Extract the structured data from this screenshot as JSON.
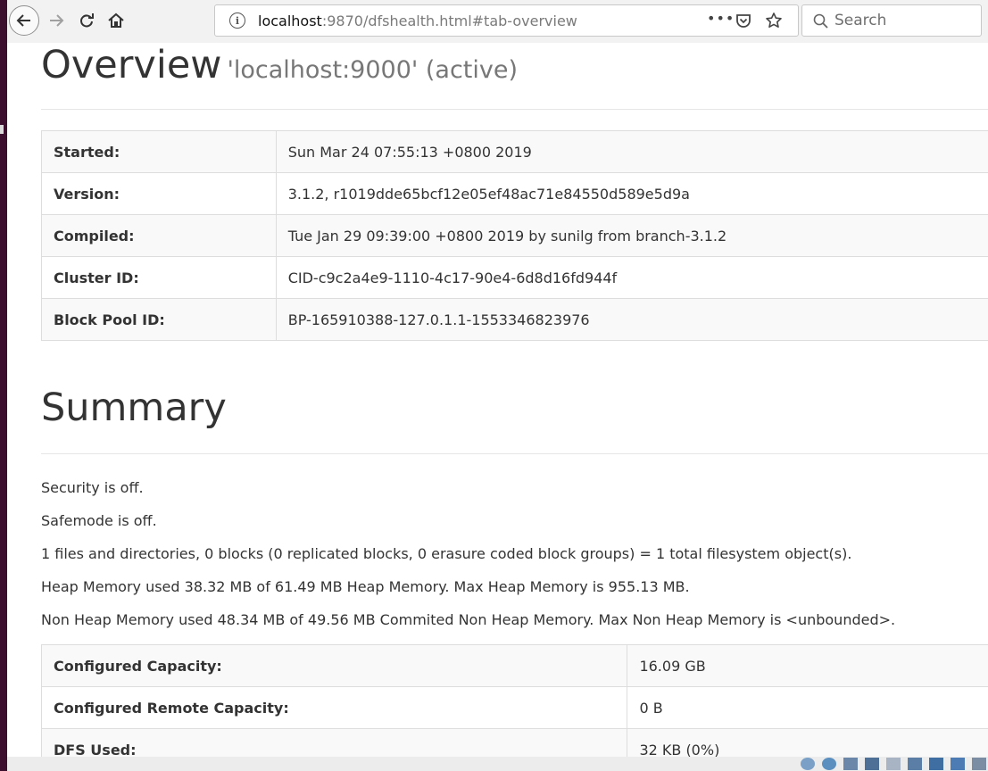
{
  "browser": {
    "url_host": "localhost",
    "url_rest": ":9870/dfshealth.html#tab-overview",
    "search_placeholder": "Search",
    "more_label": "•••"
  },
  "overview": {
    "title": "Overview",
    "subtitle": "'localhost:9000' (active)",
    "rows": [
      {
        "label": "Started:",
        "value": "Sun Mar 24 07:55:13 +0800 2019"
      },
      {
        "label": "Version:",
        "value": "3.1.2, r1019dde65bcf12e05ef48ac71e84550d589e5d9a"
      },
      {
        "label": "Compiled:",
        "value": "Tue Jan 29 09:39:00 +0800 2019 by sunilg from branch-3.1.2"
      },
      {
        "label": "Cluster ID:",
        "value": "CID-c9c2a4e9-1110-4c17-90e4-6d8d16fd944f"
      },
      {
        "label": "Block Pool ID:",
        "value": "BP-165910388-127.0.1.1-1553346823976"
      }
    ]
  },
  "summary": {
    "title": "Summary",
    "lines": [
      "Security is off.",
      "Safemode is off.",
      "1 files and directories, 0 blocks (0 replicated blocks, 0 erasure coded block groups) = 1 total filesystem object(s).",
      "Heap Memory used 38.32 MB of 61.49 MB Heap Memory. Max Heap Memory is 955.13 MB.",
      "Non Heap Memory used 48.34 MB of 49.56 MB Commited Non Heap Memory. Max Non Heap Memory is <unbounded>."
    ],
    "rows": [
      {
        "label": "Configured Capacity:",
        "value": "16.09 GB"
      },
      {
        "label": "Configured Remote Capacity:",
        "value": "0 B"
      },
      {
        "label": "DFS Used:",
        "value": "32 KB (0%)"
      }
    ]
  },
  "icons": {
    "back": "arrow-left-icon",
    "forward": "arrow-right-icon",
    "reload": "reload-icon",
    "home": "home-icon",
    "info": "info-icon",
    "pocket": "pocket-icon",
    "bookmark": "star-icon",
    "search": "search-icon"
  },
  "colors": {
    "desktop_edge": "#3b0f2d",
    "toolbar_bg": "#f2f2f2",
    "table_border": "#dddddd",
    "row_stripe": "#f9f9f9"
  }
}
